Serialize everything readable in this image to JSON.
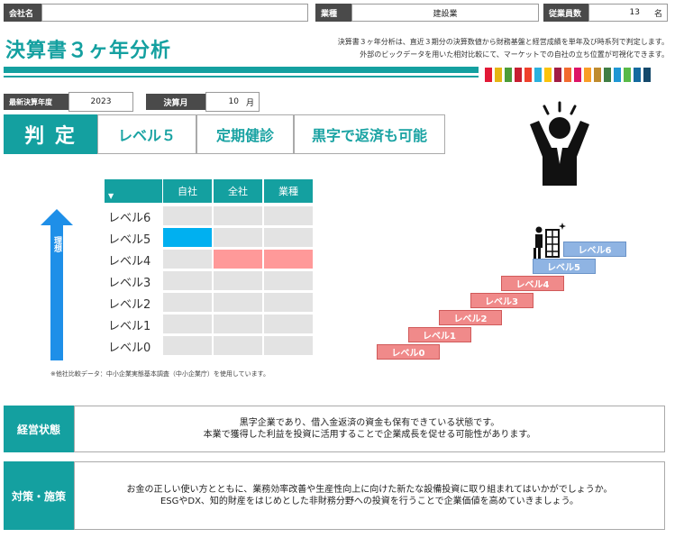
{
  "header": {
    "company_label": "会社名",
    "company_value": "",
    "industry_label": "業種",
    "industry_value": "建設業",
    "employees_label": "従業員数",
    "employees_value": "13",
    "employees_unit": "名"
  },
  "title": "決算書３ヶ年分析",
  "description": {
    "line1": "決算書３ヶ年分析は、直近３期分の決算数値から財務基盤と経営成績を単年及び時系列で判定します。",
    "line2": "外部のビックデータを用いた相対比較にて、マーケットでの自社の立ち位置が可視化できます。"
  },
  "stripe_colors": [
    "#e21836",
    "#e5b514",
    "#4b9c38",
    "#c81e32",
    "#ef402b",
    "#2ab1de",
    "#fbc30a",
    "#a21c44",
    "#f26a2e",
    "#dd1367",
    "#f99d26",
    "#bf8b2e",
    "#3f7e44",
    "#1f97d4",
    "#59ba48",
    "#136a9f",
    "#14496b"
  ],
  "fiscal": {
    "year_label": "最新決算年度",
    "year_value": "2023",
    "month_label": "決算月",
    "month_value": "10",
    "month_unit": "月"
  },
  "verdict": {
    "label": "判 定",
    "level": "レベル５",
    "checkup": "定期健診",
    "status": "黒字で返済も可能"
  },
  "level_table": {
    "columns": [
      "自社",
      "全社",
      "業種"
    ],
    "rows": [
      {
        "label": "レベル6",
        "cells": [
          "",
          "",
          ""
        ]
      },
      {
        "label": "レベル5",
        "cells": [
          "blue",
          "",
          ""
        ]
      },
      {
        "label": "レベル4",
        "cells": [
          "",
          "pink",
          "pink"
        ]
      },
      {
        "label": "レベル3",
        "cells": [
          "",
          "",
          ""
        ]
      },
      {
        "label": "レベル2",
        "cells": [
          "",
          "",
          ""
        ]
      },
      {
        "label": "レベル1",
        "cells": [
          "",
          "",
          ""
        ]
      },
      {
        "label": "レベル0",
        "cells": [
          "",
          "",
          ""
        ]
      }
    ],
    "arrow_label": "理想",
    "note": "※他社比較データ：中小企業実態基本調査（中小企業庁）を使用しています。"
  },
  "staircase": [
    "レベル0",
    "レベル1",
    "レベル2",
    "レベル3",
    "レベル4",
    "レベル5",
    "レベル6"
  ],
  "management": {
    "label": "経営状態",
    "line1": "黒字企業であり、借入金返済の資金も保有できている状態です。",
    "line2": "本業で獲得した利益を投資に活用することで企業成長を促せる可能性があります。"
  },
  "measures": {
    "label": "対策・施策",
    "line1": "お金の正しい使い方とともに、業務効率改善や生産性向上に向けた新たな設備投資に取り組まれてはいかがでしょうか。",
    "line2": "ESGやDX、知的財産をはじめとした非財務分野への投資を行うことで企業価値を高めていきましょう。"
  }
}
